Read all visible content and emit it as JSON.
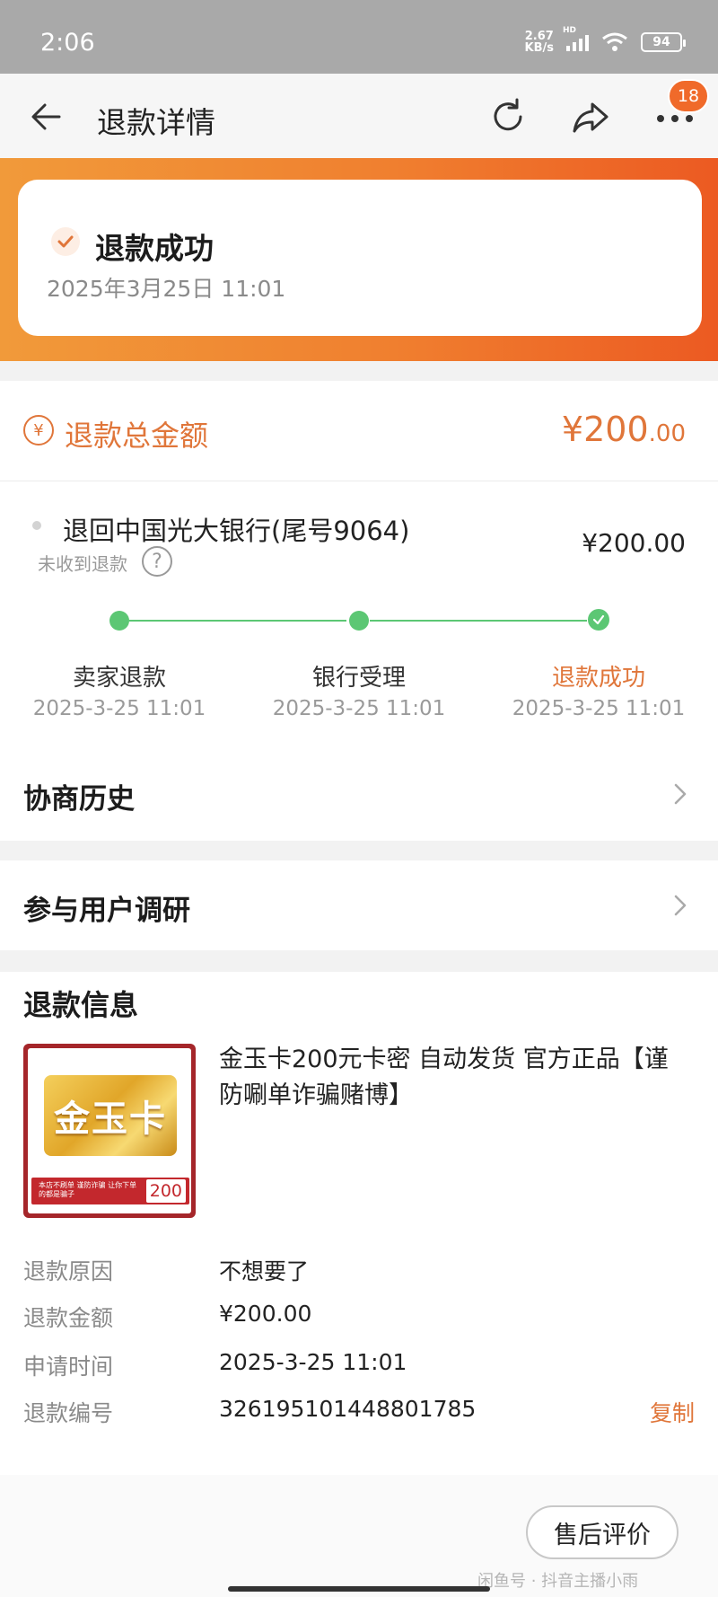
{
  "status_bar": {
    "time": "2:06",
    "net_speed_value": "2.67",
    "net_speed_unit": "KB/s",
    "signal_label": "HD",
    "battery": "94"
  },
  "nav": {
    "title": "退款详情",
    "badge_count": "18"
  },
  "hero": {
    "status": "退款成功",
    "date": "2025年3月25日 11:01"
  },
  "total": {
    "icon_char": "¥",
    "label": "退款总金额",
    "currency": "¥",
    "amount_int": "200",
    "amount_dec": ".00"
  },
  "track": {
    "bank": "退回中国光大银行(尾号9064)",
    "not_received": "未收到退款",
    "help_char": "?",
    "amount": "¥200.00",
    "steps": [
      {
        "label": "卖家退款",
        "time": "2025-3-25 11:01"
      },
      {
        "label": "银行受理",
        "time": "2025-3-25 11:01"
      },
      {
        "label": "退款成功",
        "time": "2025-3-25 11:01"
      }
    ]
  },
  "history": {
    "title": "协商历史"
  },
  "survey": {
    "title": "参与用户调研"
  },
  "refund_info": {
    "heading": "退款信息",
    "product": {
      "title": "金玉卡200元卡密 自动发货 官方正品【谨防唰单诈骗赌博】",
      "img_card_text": "金玉卡",
      "img_strip_text": "本店不刷单 谨防诈骗 让你下单的都是骗子",
      "img_strip_num": "200"
    },
    "fields": [
      {
        "key": "退款原因",
        "value": "不想要了"
      },
      {
        "key": "退款金额",
        "value": "¥200.00"
      },
      {
        "key": "申请时间",
        "value": "2025-3-25 11:01"
      },
      {
        "key": "退款编号",
        "value": "326195101448801785"
      }
    ],
    "copy_label": "复制"
  },
  "bottom": {
    "after_sale_button": "售后评价",
    "watermark": "闲鱼号 · 抖音主播小雨"
  },
  "colors": {
    "accent": "#e0763a",
    "success_green": "#5cc774",
    "badge": "#f06a2a"
  }
}
